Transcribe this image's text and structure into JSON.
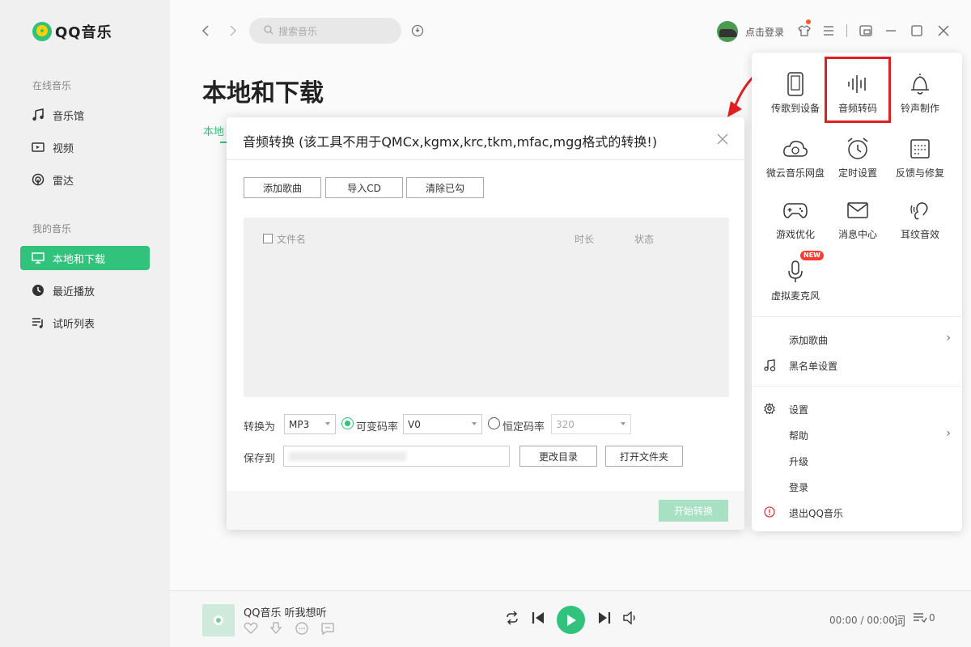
{
  "app": {
    "logo_text": "QQ音乐"
  },
  "sidebar": {
    "group_online": "在线音乐",
    "online_items": [
      {
        "label": "音乐馆",
        "icon": "music-note-icon"
      },
      {
        "label": "视频",
        "icon": "video-icon"
      },
      {
        "label": "雷达",
        "icon": "radar-icon"
      }
    ],
    "group_mine": "我的音乐",
    "my_items": [
      {
        "label": "本地和下载",
        "icon": "monitor-icon",
        "active": true
      },
      {
        "label": "最近播放",
        "icon": "clock-icon"
      },
      {
        "label": "试听列表",
        "icon": "playlist-icon"
      }
    ]
  },
  "topbar": {
    "search_placeholder": "搜索音乐",
    "login_text": "点击登录"
  },
  "page": {
    "title": "本地和下载",
    "tab_partial": "本地"
  },
  "dialog": {
    "title": "音频转换 (该工具不用于QMCx,kgmx,krc,tkm,mfac,mgg格式的转换!)",
    "btn_add": "添加歌曲",
    "btn_import_cd": "导入CD",
    "btn_clear": "清除已勾",
    "col_filename": "文件名",
    "col_duration": "时长",
    "col_status": "状态",
    "convert_label": "转换为",
    "format_value": "MP3",
    "vbr_label": "可变码率",
    "vbr_value": "V0",
    "cbr_label": "恒定码率",
    "cbr_value": "320",
    "save_label": "保存到",
    "btn_change_dir": "更改目录",
    "btn_open_folder": "打开文件夹",
    "btn_start": "开始转换"
  },
  "menu": {
    "tools": [
      {
        "label": "传歌到设备",
        "icon": "phone-icon"
      },
      {
        "label": "音频转码",
        "icon": "waveform-icon",
        "highlighted": true
      },
      {
        "label": "铃声制作",
        "icon": "bell-icon"
      },
      {
        "label": "微云音乐网盘",
        "icon": "cloud-icon"
      },
      {
        "label": "定时设置",
        "icon": "alarm-clock-icon"
      },
      {
        "label": "反馈与修复",
        "icon": "feedback-icon"
      },
      {
        "label": "游戏优化",
        "icon": "gamepad-icon"
      },
      {
        "label": "消息中心",
        "icon": "mail-icon"
      },
      {
        "label": "耳纹音效",
        "icon": "ear-icon"
      },
      {
        "label": "虚拟麦克风",
        "icon": "microphone-icon",
        "badge": "NEW"
      }
    ],
    "items_group1": [
      {
        "label": "添加歌曲",
        "has_arrow": true
      },
      {
        "label": "黑名单设置",
        "icon": "blacklist-icon"
      }
    ],
    "items_group2": [
      {
        "label": "设置",
        "icon": "gear-icon"
      },
      {
        "label": "帮助",
        "has_arrow": true
      },
      {
        "label": "升级"
      },
      {
        "label": "登录"
      },
      {
        "label": "退出QQ音乐",
        "icon": "exit-alert-icon"
      }
    ]
  },
  "player": {
    "song": "QQ音乐 听我想听",
    "time": "00:00 / 00:00",
    "lyric_label": "词",
    "queue_count": "0"
  },
  "colors": {
    "accent": "#31c27c",
    "highlight_box": "#e02020"
  }
}
